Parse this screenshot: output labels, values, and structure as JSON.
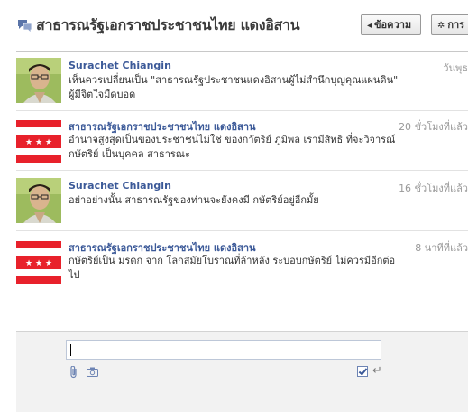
{
  "header": {
    "title": "สาธารณรัฐเอกราชประชาชนไทย แดงอิสาน",
    "back_label": "ข้อความ",
    "actions_label": "การ"
  },
  "messages": [
    {
      "sender": "Surachet Chiangin",
      "time": "วันพุธ",
      "avatar": "person-photo",
      "lines": [
        "เห็นควรเปลี่ยนเป็น \"สาธารณรัฐประชาชนแดงอิสานผู้ไม่สำนึกบุญคุณแผ่นดิน\"",
        "ผู้มีจิตใจมืดบอด"
      ]
    },
    {
      "sender": "สาธารณรัฐเอกราชประชาชนไทย แดงอิสาน",
      "time": "20 ชั่วโมงที่แล้ว",
      "avatar": "red-flag",
      "lines": [
        "อำนาจสูงสุดเป็นของประชาชนไม่ใช่ ของกาัตริย์ ภูมิพล เรามีสิทธิ ที่จะวิจารณ์",
        "กษัตริย์ เป็นบุคคล สาธารณะ"
      ]
    },
    {
      "sender": "Surachet Chiangin",
      "time": "16 ชั่วโมงที่แล้ว",
      "avatar": "person-photo",
      "lines": [
        "อย่าอย่างนั้น สาธารณรัฐของท่านจะยังคงมี กษัตริย์อยู่อีกมั้ย"
      ]
    },
    {
      "sender": "สาธารณรัฐเอกราชประชาชนไทย แดงอิสาน",
      "time": "8 นาทีที่แล้ว",
      "avatar": "red-flag",
      "lines": [
        "กษัตริย์เป็น มรดก จาก โลกสมัยโบราณที่ล้าหลัง ระบอบกษัตริย์ ไม่ควรมีอีกต่อ",
        "ไป"
      ]
    }
  ],
  "composer": {
    "reply_value": "",
    "press_enter_checked": true
  },
  "colors": {
    "link": "#3b5998",
    "flag_red": "#e8212b",
    "composer_bg": "#f2f2f2"
  }
}
